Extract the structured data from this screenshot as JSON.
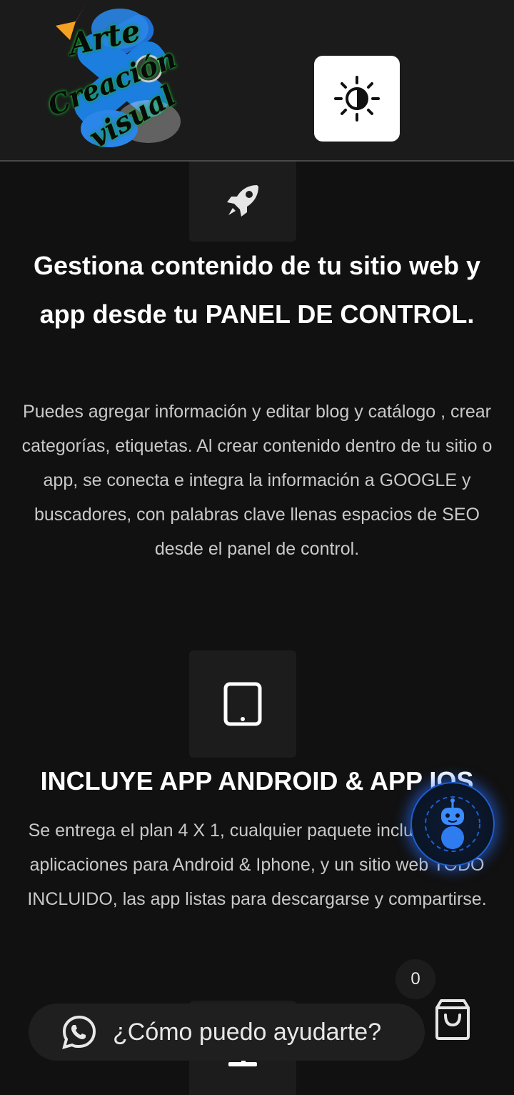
{
  "header": {
    "logo": {
      "line1": "Arte",
      "line2": "Creación",
      "line3": "visual",
      "icon": "arte-creacion-visual-logo"
    },
    "theme_toggle_icon": "contrast-sun-icon"
  },
  "features": [
    {
      "icon": "rocket-icon",
      "title": "Gestiona contenido de tu sitio web y app desde tu PANEL DE CONTROL.",
      "description": "Puedes agregar información y editar blog y catálogo , crear categorías, etiquetas. Al crear contenido dentro de tu sitio o app, se conecta e integra la información a GOOGLE y buscadores, con palabras clave llenas espacios de SEO desde el panel de control."
    },
    {
      "icon": "tablet-icon",
      "title": "INCLUYE APP ANDROID & APP IOS",
      "description": "Se entrega el plan 4 X 1, cualquier paquete incluido con 3 aplicaciones para Android & Iphone, y un sitio web TODO INCLUIDO, las app listas para descargarse y compartirse."
    },
    {
      "icon": "desktop-icon"
    }
  ],
  "chat": {
    "label": "¿Cómo puedo ayudarte?",
    "icon": "whatsapp-icon"
  },
  "cart": {
    "count": "0",
    "icon": "shopping-bag-icon"
  },
  "assistant": {
    "icon": "robot-assistant-icon"
  },
  "colors": {
    "background": "#111111",
    "header": "#1b1b1b",
    "icon_box": "#1c1c1c",
    "accent_glow": "#2a6eff"
  }
}
